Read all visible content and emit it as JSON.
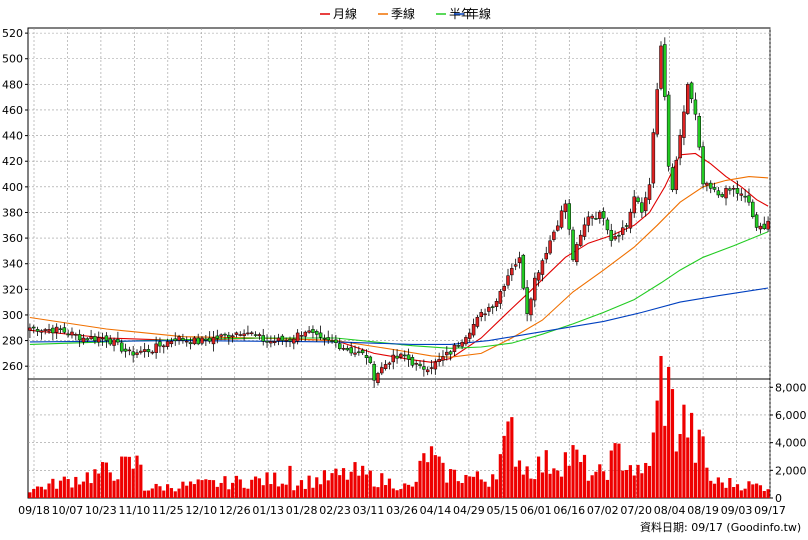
{
  "legend": [
    {
      "label": "月線",
      "color": "#e00000"
    },
    {
      "label": "季線",
      "color": "#f07000"
    },
    {
      "label": "半年",
      "color": "#22cc22"
    },
    {
      "label": "年線",
      "color": "#0040c0"
    }
  ],
  "credit": "資料日期: 09/17  (Goodinfo.tw)",
  "colors": {
    "up": "#dd2222",
    "down": "#22cc22",
    "volume": "#ee0000",
    "grid": "#999999"
  },
  "chart_data": {
    "type": "candlestick",
    "x_labels": [
      "09/18",
      "10/07",
      "10/23",
      "11/10",
      "11/25",
      "12/10",
      "12/26",
      "01/13",
      "01/28",
      "02/23",
      "03/11",
      "03/26",
      "04/14",
      "04/29",
      "05/15",
      "06/01",
      "06/16",
      "07/02",
      "07/20",
      "08/04",
      "08/19",
      "09/03",
      "09/17"
    ],
    "price_axis": {
      "ticks": [
        260,
        280,
        300,
        320,
        340,
        360,
        380,
        400,
        420,
        440,
        460,
        480,
        500,
        520
      ],
      "range": [
        250,
        524
      ],
      "grid": true
    },
    "volume_axis": {
      "ticks": [
        0,
        2000,
        4000,
        6000,
        8000
      ],
      "tick_labels": [
        "0",
        "2,000",
        "4,000",
        "6,000",
        "8,000"
      ],
      "range": [
        0,
        8600
      ],
      "grid": true
    },
    "price_anchors": [
      {
        "i": 0,
        "c": 290
      },
      {
        "i": 8,
        "c": 288
      },
      {
        "i": 14,
        "c": 282
      },
      {
        "i": 20,
        "c": 282
      },
      {
        "i": 26,
        "c": 270
      },
      {
        "i": 32,
        "c": 273
      },
      {
        "i": 38,
        "c": 282
      },
      {
        "i": 44,
        "c": 279
      },
      {
        "i": 50,
        "c": 283
      },
      {
        "i": 56,
        "c": 288
      },
      {
        "i": 62,
        "c": 279
      },
      {
        "i": 68,
        "c": 281
      },
      {
        "i": 72,
        "c": 288
      },
      {
        "i": 76,
        "c": 280
      },
      {
        "i": 80,
        "c": 278
      },
      {
        "i": 84,
        "c": 272
      },
      {
        "i": 88,
        "c": 268
      },
      {
        "i": 90,
        "c": 252
      },
      {
        "i": 94,
        "c": 265
      },
      {
        "i": 98,
        "c": 268
      },
      {
        "i": 102,
        "c": 258
      },
      {
        "i": 106,
        "c": 262
      },
      {
        "i": 110,
        "c": 271
      },
      {
        "i": 114,
        "c": 285
      },
      {
        "i": 118,
        "c": 300
      },
      {
        "i": 122,
        "c": 312
      },
      {
        "i": 126,
        "c": 338
      },
      {
        "i": 128,
        "c": 343
      },
      {
        "i": 130,
        "c": 303
      },
      {
        "i": 132,
        "c": 328
      },
      {
        "i": 136,
        "c": 358
      },
      {
        "i": 140,
        "c": 387
      },
      {
        "i": 142,
        "c": 344
      },
      {
        "i": 146,
        "c": 378
      },
      {
        "i": 150,
        "c": 378
      },
      {
        "i": 152,
        "c": 360
      },
      {
        "i": 156,
        "c": 370
      },
      {
        "i": 158,
        "c": 392
      },
      {
        "i": 160,
        "c": 380
      },
      {
        "i": 162,
        "c": 404
      },
      {
        "i": 163,
        "c": 440
      },
      {
        "i": 165,
        "c": 510
      },
      {
        "i": 166,
        "c": 468
      },
      {
        "i": 167,
        "c": 415
      },
      {
        "i": 168,
        "c": 398
      },
      {
        "i": 170,
        "c": 438
      },
      {
        "i": 172,
        "c": 480
      },
      {
        "i": 174,
        "c": 455
      },
      {
        "i": 176,
        "c": 402
      },
      {
        "i": 180,
        "c": 394
      },
      {
        "i": 184,
        "c": 398
      },
      {
        "i": 188,
        "c": 388
      },
      {
        "i": 190,
        "c": 366
      },
      {
        "i": 192,
        "c": 370
      },
      {
        "i": 193,
        "c": 374
      }
    ],
    "volume_anchors": [
      {
        "i": 0,
        "v": 600
      },
      {
        "i": 29,
        "v": 2500
      },
      {
        "i": 30,
        "v": 700
      },
      {
        "i": 67,
        "v": 1400
      },
      {
        "i": 68,
        "v": 2300
      },
      {
        "i": 69,
        "v": 1000
      },
      {
        "i": 85,
        "v": 1800
      },
      {
        "i": 100,
        "v": 700
      },
      {
        "i": 104,
        "v": 3300
      },
      {
        "i": 108,
        "v": 1800
      },
      {
        "i": 120,
        "v": 1300
      },
      {
        "i": 126,
        "v": 4600
      },
      {
        "i": 128,
        "v": 2800
      },
      {
        "i": 130,
        "v": 2100
      },
      {
        "i": 138,
        "v": 2700
      },
      {
        "i": 142,
        "v": 3000
      },
      {
        "i": 148,
        "v": 1400
      },
      {
        "i": 154,
        "v": 3200
      },
      {
        "i": 160,
        "v": 1500
      },
      {
        "i": 163,
        "v": 3800
      },
      {
        "i": 165,
        "v": 8500
      },
      {
        "i": 167,
        "v": 7600
      },
      {
        "i": 169,
        "v": 5000
      },
      {
        "i": 172,
        "v": 5500
      },
      {
        "i": 174,
        "v": 3500
      },
      {
        "i": 176,
        "v": 3600
      },
      {
        "i": 178,
        "v": 1200
      },
      {
        "i": 193,
        "v": 800
      }
    ],
    "moving_averages": [
      {
        "name": "月線",
        "color": "#e00000",
        "points": [
          [
            0,
            288
          ],
          [
            20,
            282
          ],
          [
            40,
            280
          ],
          [
            60,
            282
          ],
          [
            80,
            280
          ],
          [
            90,
            270
          ],
          [
            100,
            265
          ],
          [
            105,
            263
          ],
          [
            110,
            266
          ],
          [
            118,
            282
          ],
          [
            126,
            305
          ],
          [
            132,
            322
          ],
          [
            140,
            345
          ],
          [
            146,
            356
          ],
          [
            152,
            362
          ],
          [
            158,
            370
          ],
          [
            162,
            380
          ],
          [
            166,
            400
          ],
          [
            170,
            425
          ],
          [
            174,
            426
          ],
          [
            178,
            418
          ],
          [
            182,
            408
          ],
          [
            186,
            400
          ],
          [
            190,
            390
          ],
          [
            193,
            385
          ]
        ]
      },
      {
        "name": "季線",
        "color": "#f07000",
        "points": [
          [
            0,
            298
          ],
          [
            20,
            289
          ],
          [
            40,
            283
          ],
          [
            60,
            282
          ],
          [
            80,
            280
          ],
          [
            95,
            273
          ],
          [
            105,
            268
          ],
          [
            110,
            267
          ],
          [
            118,
            270
          ],
          [
            126,
            282
          ],
          [
            134,
            296
          ],
          [
            142,
            318
          ],
          [
            150,
            335
          ],
          [
            158,
            353
          ],
          [
            164,
            370
          ],
          [
            170,
            388
          ],
          [
            176,
            400
          ],
          [
            182,
            405
          ],
          [
            188,
            408
          ],
          [
            193,
            407
          ]
        ]
      },
      {
        "name": "半年",
        "color": "#22cc22",
        "points": [
          [
            0,
            277
          ],
          [
            30,
            280
          ],
          [
            60,
            282
          ],
          [
            80,
            282
          ],
          [
            100,
            276
          ],
          [
            110,
            274
          ],
          [
            118,
            275
          ],
          [
            126,
            278
          ],
          [
            134,
            285
          ],
          [
            142,
            293
          ],
          [
            150,
            302
          ],
          [
            158,
            312
          ],
          [
            165,
            325
          ],
          [
            170,
            335
          ],
          [
            176,
            345
          ],
          [
            184,
            354
          ],
          [
            193,
            365
          ]
        ]
      },
      {
        "name": "年線",
        "color": "#0040c0",
        "points": [
          [
            0,
            279
          ],
          [
            40,
            280
          ],
          [
            80,
            279
          ],
          [
            100,
            277
          ],
          [
            110,
            277
          ],
          [
            120,
            280
          ],
          [
            130,
            285
          ],
          [
            140,
            290
          ],
          [
            150,
            295
          ],
          [
            160,
            302
          ],
          [
            170,
            310
          ],
          [
            180,
            315
          ],
          [
            193,
            321
          ]
        ]
      }
    ]
  }
}
